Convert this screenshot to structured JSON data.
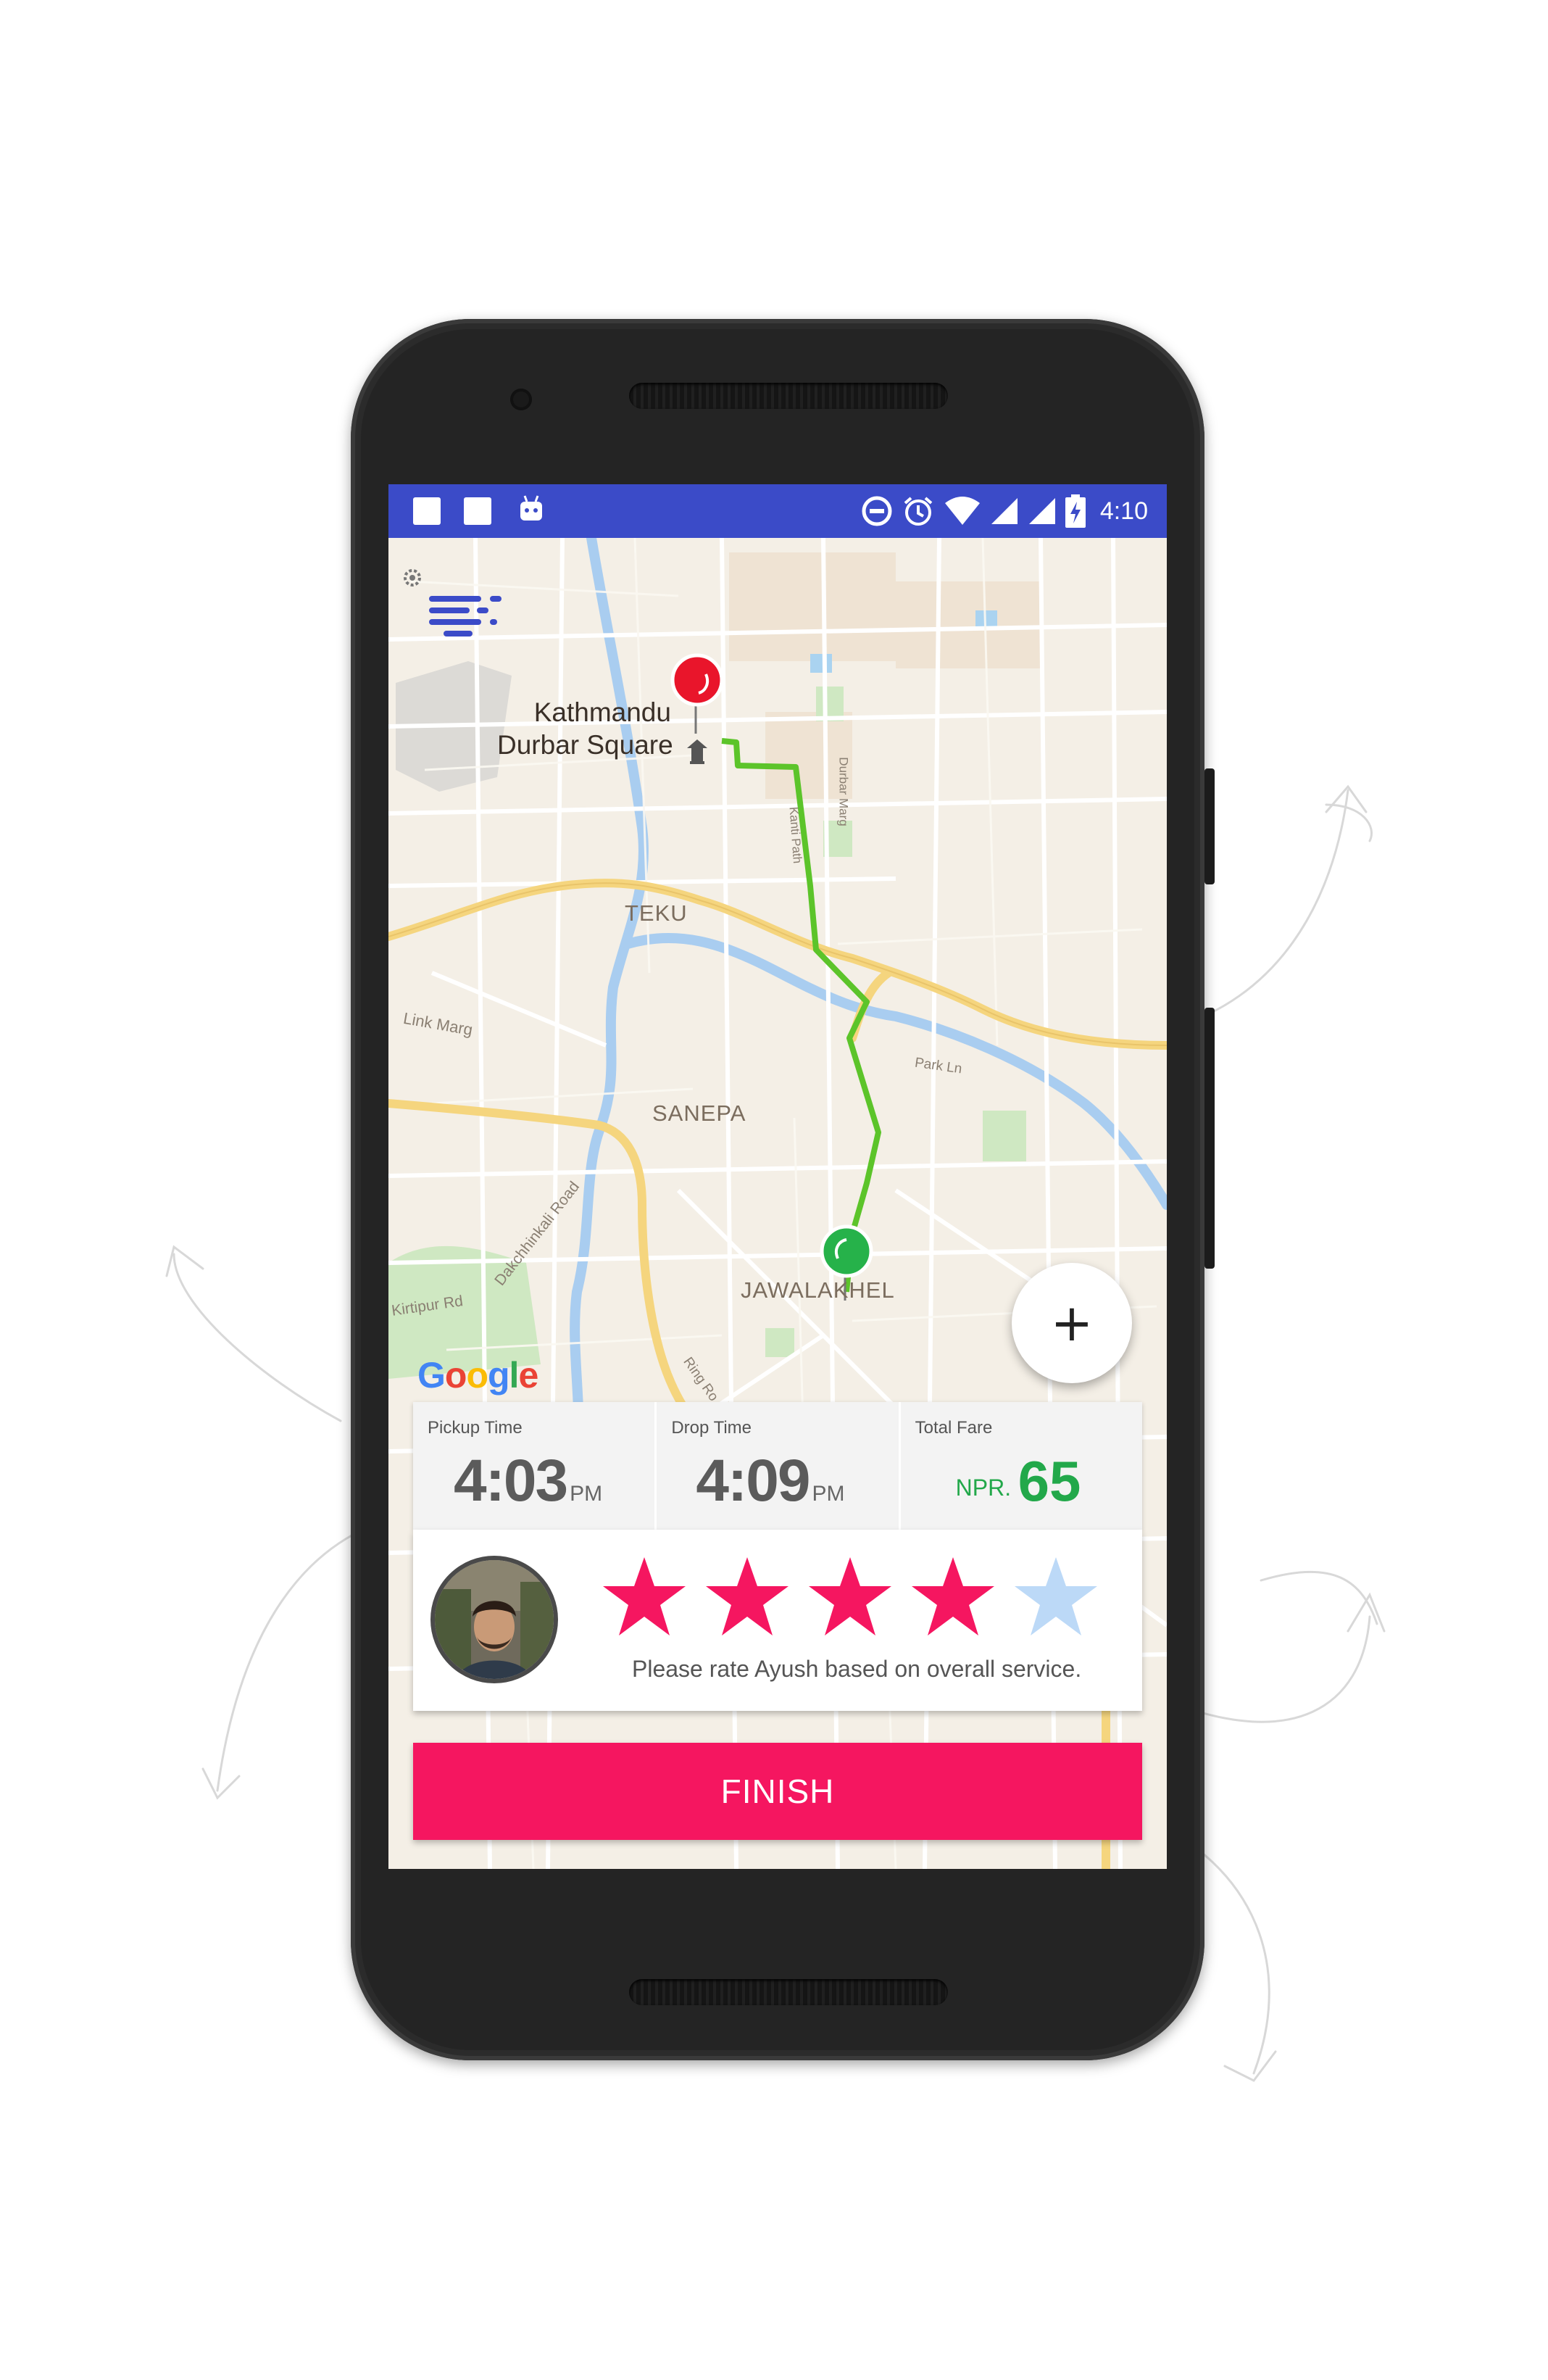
{
  "status_bar": {
    "time": "4:10"
  },
  "map": {
    "place_label": "Kathmandu\nDurbar Square",
    "place_line1": "Kathmandu",
    "place_line2": "Durbar Square",
    "area_teku": "TEKU",
    "area_sanepa": "SANEPA",
    "area_jawalakhel": "JAWALAKHEL",
    "roads": {
      "link_marg": "Link Marg",
      "park_ln": "Park Ln",
      "kirtipur_rd": "Kirtipur Rd",
      "dakchhinkali_road": "Dakchhinkali Road",
      "ring_road": "Ring Ro",
      "durbar_marg": "Durbar Marg",
      "kanti_path": "Kanti Path"
    },
    "attribution": "Google",
    "zoom_in_label": "+"
  },
  "trip": {
    "pickup_label": "Pickup Time",
    "pickup_time": "4:03",
    "pickup_ampm": "PM",
    "drop_label": "Drop Time",
    "drop_time": "4:09",
    "drop_ampm": "PM",
    "fare_label": "Total Fare",
    "fare_currency": "NPR.",
    "fare_value": "65"
  },
  "rating": {
    "stars_filled": 4,
    "stars_total": 5,
    "prompt": "Please rate Ayush based on overall service."
  },
  "actions": {
    "finish_label": "FINISH"
  },
  "colors": {
    "status_bar": "#3b4bc8",
    "accent_pink": "#f51660",
    "fare_green": "#22a84a",
    "route_green": "#5cc42a",
    "star_empty": "#bcd9f7"
  }
}
